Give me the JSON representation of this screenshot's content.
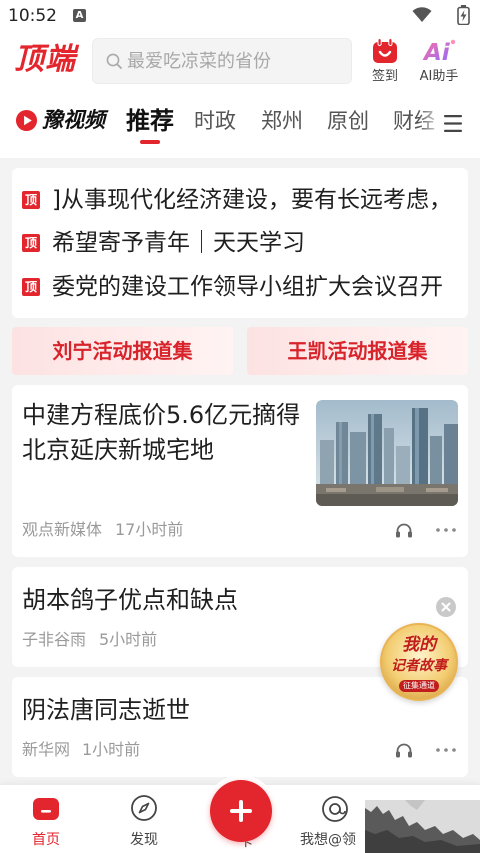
{
  "status_bar": {
    "time": "10:52",
    "notification_badge": "A",
    "icons": [
      "wifi-icon",
      "battery-charging-icon"
    ]
  },
  "header": {
    "logo": "顶端",
    "search": {
      "placeholder": "最爱吃凉菜的省份",
      "icon": "search-icon"
    },
    "checkin": {
      "label": "签到",
      "icon": "calendar-checkin-icon"
    },
    "ai_assistant": {
      "label": "AI助手",
      "icon_text": "Ai"
    }
  },
  "channel_tabs": {
    "video_brand": "豫视频",
    "items": [
      {
        "label": "推荐",
        "active": true
      },
      {
        "label": "时政",
        "active": false
      },
      {
        "label": "郑州",
        "active": false
      },
      {
        "label": "原创",
        "active": false
      },
      {
        "label": "财经",
        "active": false
      }
    ],
    "menu_icon": "menu-icon"
  },
  "headlines": {
    "badge": "顶",
    "items": [
      "]从事现代化经济建设，要有长远考虑，",
      "希望寄予青年｜天天学习",
      "委党的建设工作领导小组扩大会议召开"
    ]
  },
  "topic_buttons": [
    {
      "label": "刘宁活动报道集"
    },
    {
      "label": "王凯活动报道集"
    }
  ],
  "articles": [
    {
      "title": "中建方程底价5.6亿元摘得北京延庆新城宅地",
      "source": "观点新媒体",
      "time": "17小时前"
    },
    {
      "title": "胡本鸽子优点和缺点",
      "source": "子非谷雨",
      "time": "5小时前"
    },
    {
      "title": "阴法唐同志逝世",
      "source": "新华网",
      "time": "1小时前"
    }
  ],
  "floating_badge": {
    "line1": "我的",
    "line2": "记者故事",
    "tag": "征集通道"
  },
  "bottom_nav": {
    "items": [
      {
        "label": "首页",
        "icon": "home-icon",
        "active": true
      },
      {
        "label": "发现",
        "icon": "compass-icon",
        "active": false
      },
      {
        "label": "卡",
        "icon": "plus-icon",
        "active": false
      },
      {
        "label": "我想@领",
        "icon": "target-at-icon",
        "active": false
      }
    ]
  },
  "colors": {
    "brand_red": "#e3262d",
    "text_primary": "#1f1f1f",
    "text_secondary": "#9a9a9a",
    "page_background": "#f3f3f3",
    "topic_button_background": "#fde2e2"
  }
}
